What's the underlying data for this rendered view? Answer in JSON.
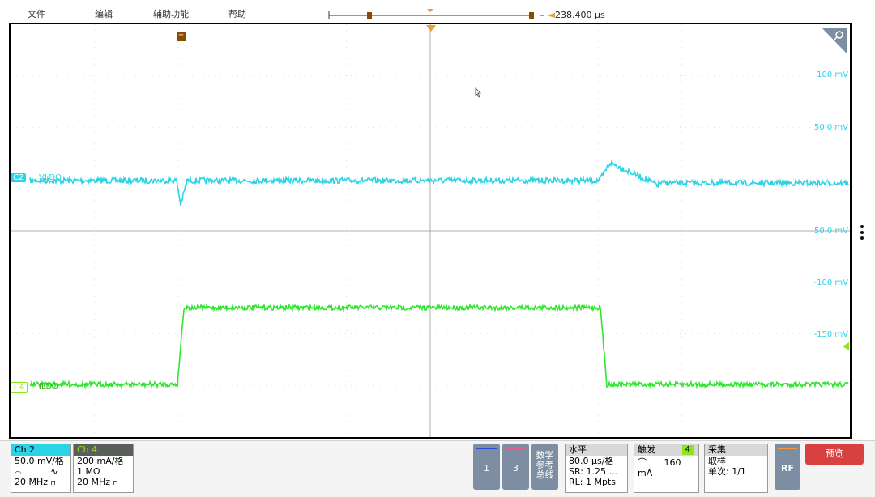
{
  "menu": {
    "file": "文件",
    "edit": "编辑",
    "utility": "辅助功能",
    "help": "帮助"
  },
  "timebase": {
    "readout": "238.400 µs"
  },
  "y_axis_labels": [
    "100 mV",
    "50.0 mV",
    "-50.0 mV",
    "-100 mV",
    "-150 mV"
  ],
  "channels": {
    "c2": {
      "tag": "C2",
      "name": "VLDO",
      "color": "#2ad3e6"
    },
    "c4": {
      "tag": "C4",
      "name": "ILDO",
      "color": "#2ee62e"
    }
  },
  "badges": {
    "ch2": {
      "title": "Ch 2",
      "scale": "50.0 mV/格",
      "bw": "20 MHz",
      "color": "#2ad3e6"
    },
    "ch4": {
      "title": "Ch 4",
      "scale": "200 mA/格",
      "impedance": "1 MΩ",
      "bw": "20 MHz",
      "head_bg": "#5a5f5a",
      "title_color": "#8ee61a"
    },
    "btn1": "1",
    "btn3": "3",
    "math": "数学\n参考\n总线",
    "math_l1": "数学",
    "math_l2": "参考",
    "math_l3": "总线",
    "horizontal": {
      "title": "水平",
      "scale": "80.0 µs/格",
      "sr": "SR: 1.25 ...",
      "rl": "RL: 1 Mpts"
    },
    "trigger": {
      "title": "触发",
      "source": "4",
      "level": "160 mA"
    },
    "acquire": {
      "title": "采集",
      "mode": "取样",
      "single": "单次: 1/1"
    },
    "rf": "RF",
    "preview": "预览"
  }
}
